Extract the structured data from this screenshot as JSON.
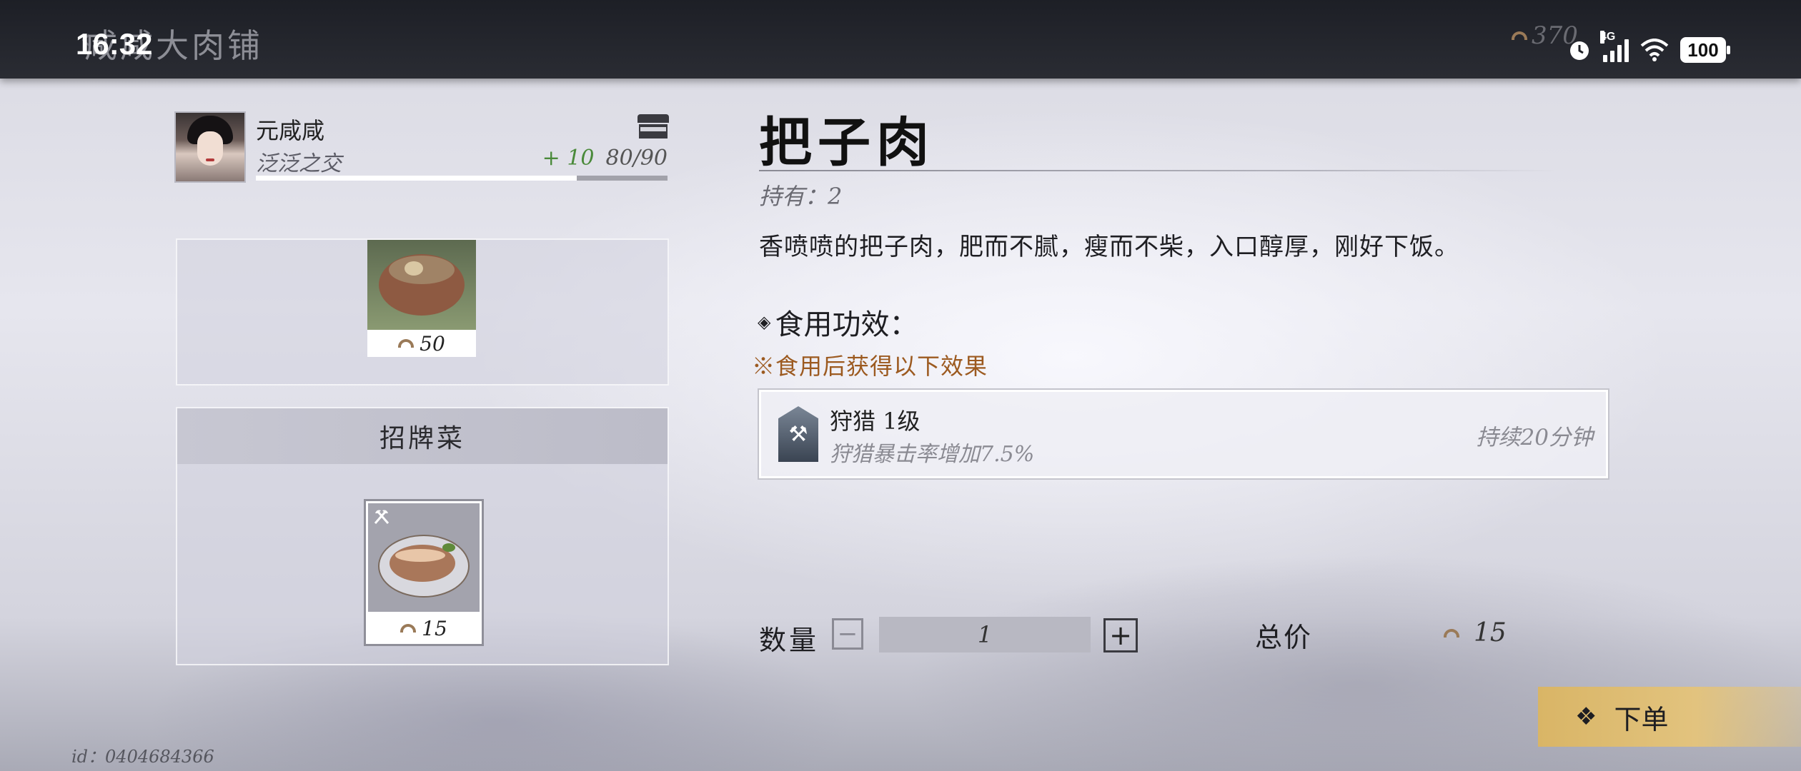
{
  "status_bar": {
    "time": "16:32",
    "network": "4G",
    "battery": "100"
  },
  "header": {
    "shop_name": "咸咸大肉铺",
    "currency_amount": "370"
  },
  "character": {
    "name": "元咸咸",
    "relationship": "泛泛之交",
    "affinity_gain": "+ 10",
    "affinity": "80/90",
    "affinity_progress": 0.78
  },
  "menu": {
    "top_dish": {
      "price": "50"
    },
    "signature_header": "招牌菜",
    "signature_dish": {
      "price": "15",
      "icon": "hunting-axes-icon"
    }
  },
  "item": {
    "name": "把子肉",
    "owned": "持有：2",
    "description": "香喷喷的把子肉，肥而不腻，瘦而不柴，入口醇厚，刚好下饭。",
    "effect_title": "食用功效：",
    "effect_note": "※食用后获得以下效果",
    "effect": {
      "name": "狩猎 1级",
      "desc": "狩猎暴击率增加7.5%",
      "duration": "持续20分钟",
      "icon": "hunting-axes-icon"
    }
  },
  "order": {
    "qty_label": "数量",
    "qty_value": "1",
    "total_label": "总价",
    "total_value": "15",
    "button_label": "下单"
  },
  "footer": {
    "id": "id：0404684366"
  },
  "colors": {
    "accent_gold": "#d9b566",
    "effect_note": "#9c5a20",
    "affinity_plus": "#4a8a3a"
  }
}
